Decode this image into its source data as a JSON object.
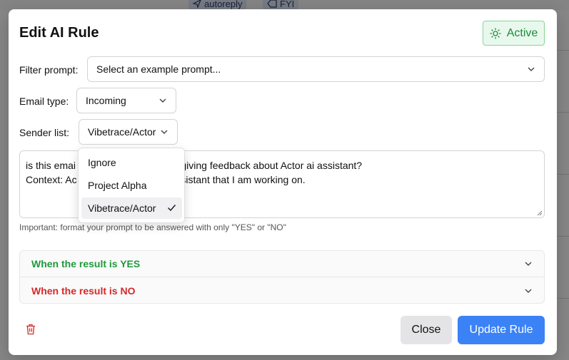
{
  "background": {
    "tags": [
      {
        "icon": "send-icon",
        "label": "autoreply"
      },
      {
        "icon": "tag-icon",
        "label": "FYI"
      }
    ]
  },
  "dialog": {
    "title": "Edit AI Rule",
    "status_label": "Active",
    "status_icon": "sun-icon"
  },
  "form": {
    "filter_prompt": {
      "label": "Filter prompt:",
      "value": "Select an example prompt..."
    },
    "email_type": {
      "label": "Email type:",
      "value": "Incoming"
    },
    "sender_list": {
      "label": "Sender list:",
      "value": "Vibetrace/Actor",
      "options": [
        "Ignore",
        "Project Alpha",
        "Vibetrace/Actor"
      ],
      "selected": "Vibetrace/Actor"
    },
    "prompt": {
      "line1_a": "is this emai",
      "line1_b": "or giving feedback about Actor ai assistant?",
      "line2_a": "Context: Ac",
      "line2_b": "assistant that I am working on."
    },
    "hint": "Important: format your prompt to be answered with only \"YES\" or \"NO\""
  },
  "results": {
    "yes_label": "When the result is YES",
    "no_label": "When the result is NO"
  },
  "actions": {
    "close_label": "Close",
    "update_label": "Update Rule"
  },
  "colors": {
    "accent": "#3b82f6",
    "active_green": "#1e8a3c",
    "yes_green": "#1f9a3c",
    "no_red": "#d42a2a"
  }
}
